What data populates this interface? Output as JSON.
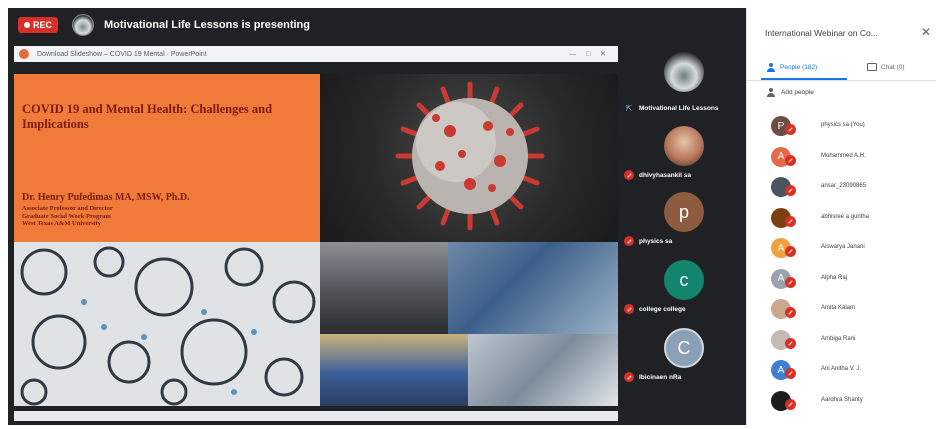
{
  "topbar": {
    "rec_label": "REC",
    "presenting_text": "Motivational Life Lessons is presenting"
  },
  "ppt": {
    "title": "Download Slideshow – COVID 19 Mental · PowerPoint",
    "controls": "— □ ✕"
  },
  "slide": {
    "title": "COVID 19 and Mental Health: Challenges and Implications",
    "author": "Dr. Henry Pufedimas MA, MSW, Ph.D.",
    "affiliation_lines": [
      "Associate Professor and Director",
      "Graduate Social Work Program",
      "West Texas A&M University"
    ]
  },
  "tiles": [
    {
      "name": "Motivational Life Lessons",
      "avatar_type": "logo",
      "color": "#5f6a6f",
      "presenting": true
    },
    {
      "name": "dhivyhasankil sa",
      "avatar_type": "photo",
      "color": "#c98b6a"
    },
    {
      "name": "physics sa",
      "initial": "p",
      "color": "#8d5b3f"
    },
    {
      "name": "college college",
      "initial": "c",
      "color": "#12856f"
    },
    {
      "name": "Ibicinaen nRa",
      "initial": "C",
      "color": "#8aa0b6"
    }
  ],
  "panel": {
    "header": "International Webinar on Co...",
    "close_icon": "close-icon",
    "tab_people": "People (182)",
    "tab_chat": "Chat (0)",
    "add_people": "Add people",
    "accent": "#1a73e8",
    "participants": [
      {
        "name": "physics sa (You)",
        "initial": "P",
        "color": "#6d4c41"
      },
      {
        "name": "Mohammed A.H.",
        "initial": "A",
        "color": "#e8684a"
      },
      {
        "name": "ansar_23090865",
        "initial": "",
        "color": "#4b5562"
      },
      {
        "name": "abhisree a guntha",
        "initial": "",
        "color": "#7b3f10"
      },
      {
        "name": "Aiswarya Janani",
        "initial": "A",
        "color": "#f29f3d"
      },
      {
        "name": "Alpha Raj",
        "initial": "A",
        "color": "#9aa3ad"
      },
      {
        "name": "Amita Kalam",
        "initial": "",
        "color": "#caa88f"
      },
      {
        "name": "Ambiga Rani",
        "initial": "",
        "color": "#c7b9b4"
      },
      {
        "name": "Ani Anitha V. J.",
        "initial": "A",
        "color": "#3f7fd6"
      },
      {
        "name": "Aardhra Shanty",
        "initial": "",
        "color": "#1c1c1c"
      }
    ]
  }
}
